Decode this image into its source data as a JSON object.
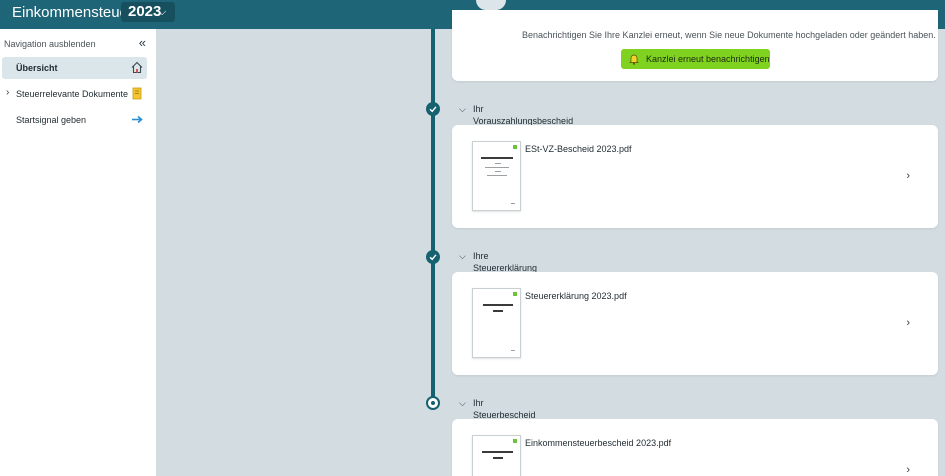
{
  "header": {
    "app_title": "Einkommensteuer",
    "year": "2023"
  },
  "sidebar": {
    "toggle_label": "Navigation ausblenden",
    "items": [
      {
        "label": "Übersicht",
        "active": true,
        "icon": "home-icon"
      },
      {
        "label": "Steuerrelevante Dokumente",
        "active": false,
        "icon": "document-icon"
      },
      {
        "label": "Startsignal geben",
        "active": false,
        "icon": "arrow-right-icon"
      }
    ]
  },
  "notice": {
    "text": "Benachrichtigen Sie Ihre Kanzlei erneut, wenn Sie neue Dokumente hochgeladen oder geändert haben.",
    "button_label": "Kanzlei erneut benachrichtigen"
  },
  "sections": [
    {
      "title": "Ihr Vorauszahlungsbescheid",
      "status": "completed",
      "document": "ESt-VZ-Bescheid 2023.pdf"
    },
    {
      "title": "Ihre Steuererklärung",
      "status": "completed",
      "document": "Steuererklärung 2023.pdf"
    },
    {
      "title": "Ihr Steuerbescheid",
      "status": "current",
      "document": "Einkommensteuerbescheid 2023.pdf"
    }
  ],
  "colors": {
    "header": "#1d6577",
    "timeline": "#15616f",
    "accent_button": "#7fd320",
    "background": "#d3dde1"
  }
}
